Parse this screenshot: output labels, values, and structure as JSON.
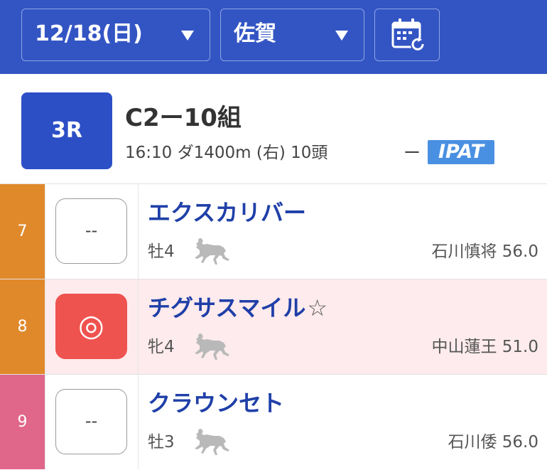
{
  "header": {
    "date_label": "12/18(日)",
    "venue_label": "佐賀",
    "calendar_icon": "calendar-refresh-icon"
  },
  "race": {
    "number": "3R",
    "name": "C2ー10組",
    "info": "16:10 ダ1400m (右) 10頭",
    "dash": "ー",
    "betting_badge": "IPAT"
  },
  "colors": {
    "header_bg": "#3355c4",
    "race_badge": "#2d4fc6",
    "ipat_badge": "#4a90e2",
    "horse_name": "#1f3fa8",
    "highlight_row": "#fdebed",
    "mark_selected": "#ef5350"
  },
  "horses": [
    {
      "number": "7",
      "number_color": "#e0892b",
      "mark": "--",
      "selected": false,
      "name": "エクスカリバー",
      "favorite": "",
      "sex_age": "牡4",
      "jockey": "石川慎将 56.0",
      "row_bg": "#ffffff"
    },
    {
      "number": "8",
      "number_color": "#e0892b",
      "mark": "◎",
      "selected": true,
      "name": "チグサスマイル",
      "favorite": "☆",
      "sex_age": "牝4",
      "jockey": "中山蓮王 51.0",
      "row_bg": "#fdebed"
    },
    {
      "number": "9",
      "number_color": "#e0668a",
      "mark": "--",
      "selected": false,
      "name": "クラウンセト",
      "favorite": "",
      "sex_age": "牡3",
      "jockey": "石川倭 56.0",
      "row_bg": "#ffffff"
    }
  ]
}
